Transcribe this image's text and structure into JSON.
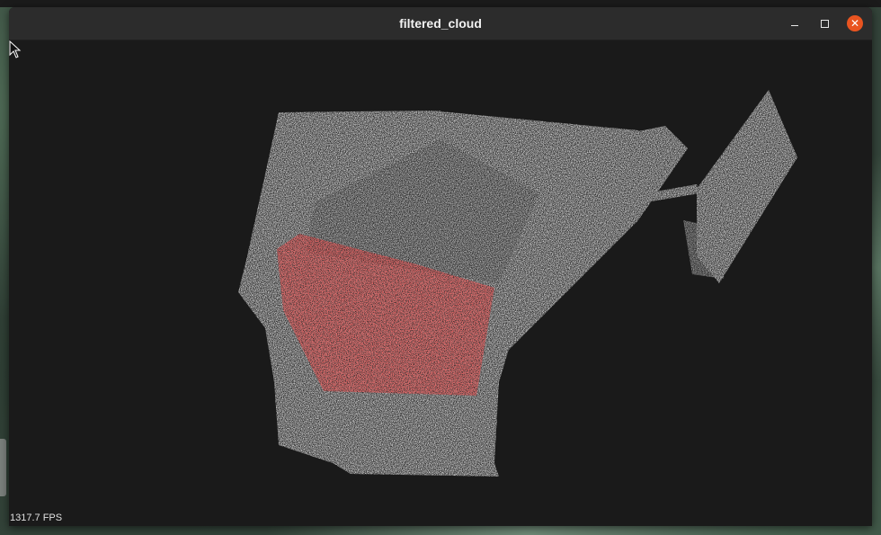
{
  "window": {
    "title": "filtered_cloud",
    "minimize_icon": "minimize-icon",
    "maximize_icon": "maximize-icon",
    "close_icon": "close-icon",
    "close_color": "#e95420"
  },
  "viewer": {
    "background": "#1a1a1a",
    "cloud_color": "#ffffff",
    "highlight_color": "#ff4a4a",
    "fps_label": "1317.7 FPS"
  }
}
